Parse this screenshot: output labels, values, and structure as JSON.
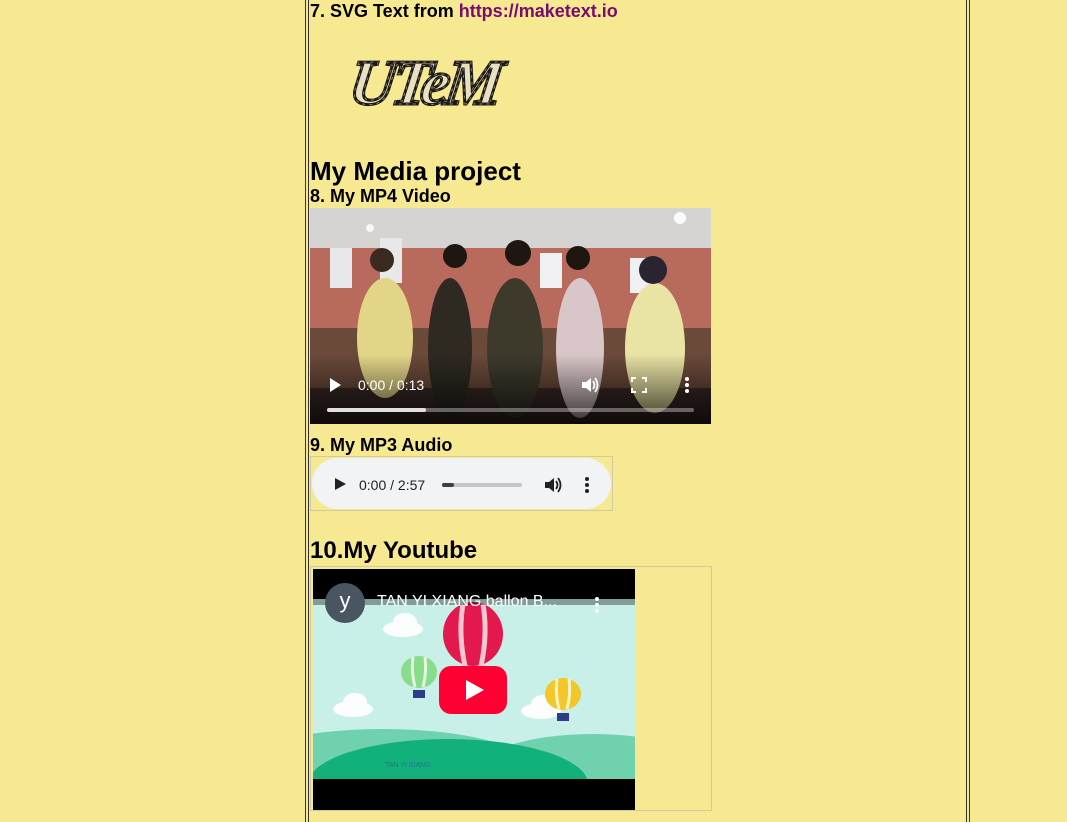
{
  "svg_section": {
    "heading_prefix": "7. SVG Text from ",
    "link_text": "https://maketext.io",
    "logo_text": "UTeM"
  },
  "media": {
    "title": "My Media project"
  },
  "video": {
    "heading": "8. My MP4 Video",
    "time": "0:00 / 0:13",
    "buffered_fraction": 0.27
  },
  "audio": {
    "heading": "9. My MP3 Audio",
    "time": "0:00 / 2:57",
    "progress_fraction": 0.15
  },
  "youtube": {
    "heading": "10.My Youtube",
    "avatar_letter": "y",
    "video_title": "TAN YI XIANG ballon B...",
    "watermark": "TAN YI XIANG"
  },
  "colors": {
    "page_background": "#f7e992",
    "link": "#7a0a6d",
    "yt_red": "#ff0033",
    "sky": "#c8f0e8",
    "hill": "#12b07a"
  },
  "icons": [
    "play-icon",
    "volume-icon",
    "fullscreen-icon",
    "more-vert-icon",
    "youtube-play-icon",
    "hot-air-balloon",
    "cloud"
  ]
}
